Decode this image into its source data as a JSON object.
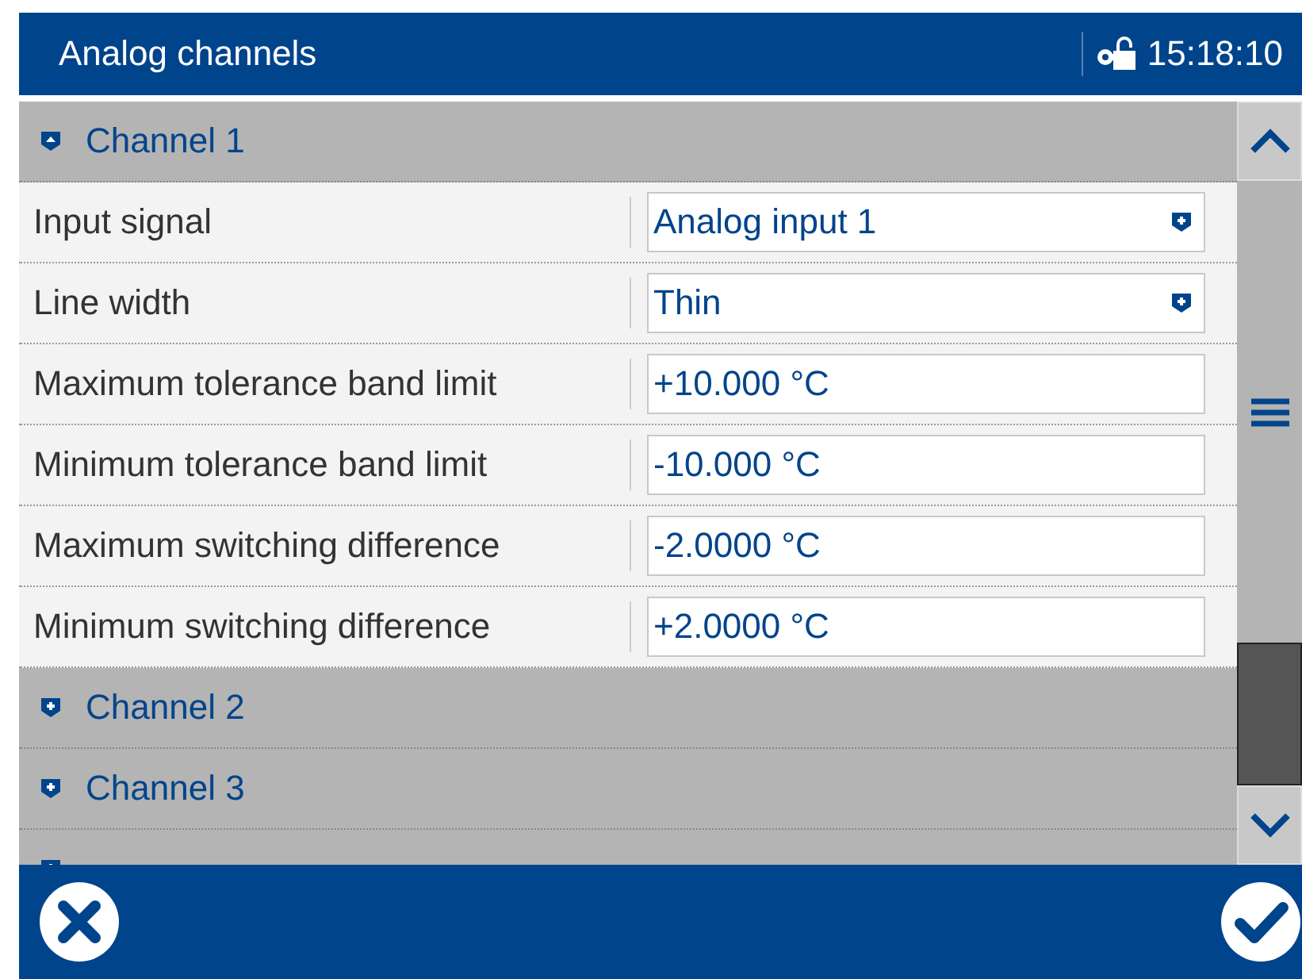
{
  "window": {
    "title": "Analog channels",
    "time": "15:18:10"
  },
  "sections": [
    {
      "label": "Channel 1",
      "expanded": true,
      "rows": [
        {
          "label": "Input signal",
          "kind": "select",
          "value": "Analog input 1"
        },
        {
          "label": "Line width",
          "kind": "select",
          "value": "Thin"
        },
        {
          "label": "Maximum tolerance band limit",
          "kind": "text",
          "value": "+10.000 °C"
        },
        {
          "label": "Minimum tolerance band limit",
          "kind": "text",
          "value": "-10.000 °C"
        },
        {
          "label": "Maximum switching difference",
          "kind": "text",
          "value": "-2.0000 °C"
        },
        {
          "label": "Minimum switching difference",
          "kind": "text",
          "value": "+2.0000 °C"
        }
      ]
    },
    {
      "label": "Channel 2",
      "expanded": false
    },
    {
      "label": "Channel 3",
      "expanded": false
    },
    {
      "expanded": false
    }
  ]
}
